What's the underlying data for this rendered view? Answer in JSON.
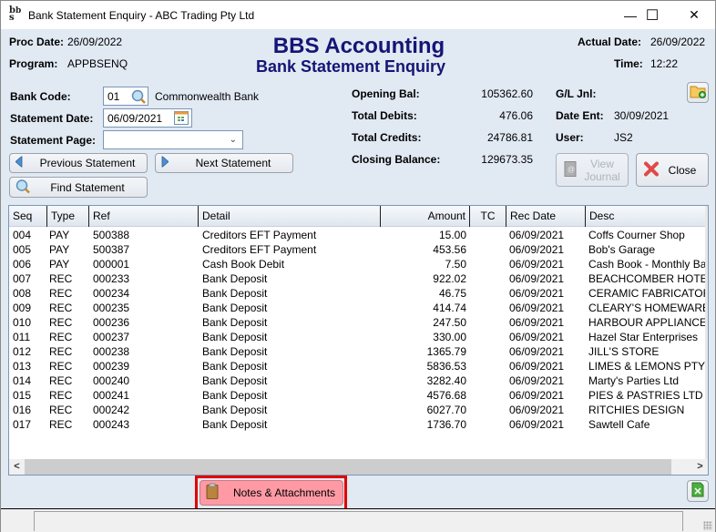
{
  "window": {
    "title": "Bank Statement Enquiry - ABC Trading Pty Ltd",
    "app_icon": "bbs-logo-icon",
    "controls": {
      "minimize": "—",
      "maximize": "☐",
      "close": "✕"
    }
  },
  "header": {
    "proc_date_label": "Proc Date:",
    "proc_date": "26/09/2022",
    "program_label": "Program:",
    "program": "APPBSENQ",
    "title": "BBS Accounting",
    "subtitle": "Bank Statement Enquiry",
    "actual_date_label": "Actual Date:",
    "actual_date": "26/09/2022",
    "time_label": "Time:",
    "time": "12:22",
    "title_color": "#151575"
  },
  "form": {
    "bank_code_label": "Bank Code:",
    "bank_code": "01",
    "bank_name": "Commonwealth Bank",
    "statement_date_label": "Statement Date:",
    "statement_date": "06/09/2021",
    "statement_page_label": "Statement Page:",
    "statement_page": ""
  },
  "buttons": {
    "previous_statement": "Previous Statement",
    "next_statement": "Next Statement",
    "find_statement": "Find Statement",
    "view_journal_line1": "View",
    "view_journal_line2": "Journal",
    "close": "Close",
    "notes_attachments": "Notes & Attachments"
  },
  "summary": {
    "opening_bal_label": "Opening Bal:",
    "opening_bal": "105362.60",
    "total_debits_label": "Total Debits:",
    "total_debits": "476.06",
    "total_credits_label": "Total Credits:",
    "total_credits": "24786.81",
    "closing_balance_label": "Closing Balance:",
    "closing_balance": "129673.35",
    "gl_jnl_label": "G/L Jnl:",
    "gl_jnl": "",
    "date_ent_label": "Date Ent:",
    "date_ent": "30/09/2021",
    "user_label": "User:",
    "user": "JS2"
  },
  "table": {
    "columns": [
      "Seq",
      "Type",
      "Ref",
      "Detail",
      "Amount",
      "TC",
      "Rec Date",
      "Desc"
    ],
    "rows": [
      [
        "004",
        "PAY",
        "500388",
        "Creditors EFT Payment",
        "15.00",
        "",
        "06/09/2021",
        "Coffs Courner Shop"
      ],
      [
        "005",
        "PAY",
        "500387",
        "Creditors EFT Payment",
        "453.56",
        "",
        "06/09/2021",
        "Bob's Garage"
      ],
      [
        "006",
        "PAY",
        "000001",
        "Cash Book Debit",
        "7.50",
        "",
        "06/09/2021",
        "Cash Book - Monthly Bar"
      ],
      [
        "007",
        "REC",
        "000233",
        "Bank Deposit",
        "922.02",
        "",
        "06/09/2021",
        "BEACHCOMBER HOTEL"
      ],
      [
        "008",
        "REC",
        "000234",
        "Bank Deposit",
        "46.75",
        "",
        "06/09/2021",
        "CERAMIC FABRICATORS"
      ],
      [
        "009",
        "REC",
        "000235",
        "Bank Deposit",
        "414.74",
        "",
        "06/09/2021",
        "CLEARY'S HOMEWARES"
      ],
      [
        "010",
        "REC",
        "000236",
        "Bank Deposit",
        "247.50",
        "",
        "06/09/2021",
        "HARBOUR APPLIANCES"
      ],
      [
        "011",
        "REC",
        "000237",
        "Bank Deposit",
        "330.00",
        "",
        "06/09/2021",
        "Hazel Star Enterprises"
      ],
      [
        "012",
        "REC",
        "000238",
        "Bank Deposit",
        "1365.79",
        "",
        "06/09/2021",
        "JILL'S STORE"
      ],
      [
        "013",
        "REC",
        "000239",
        "Bank Deposit",
        "5836.53",
        "",
        "06/09/2021",
        "LIMES & LEMONS PTY L"
      ],
      [
        "014",
        "REC",
        "000240",
        "Bank Deposit",
        "3282.40",
        "",
        "06/09/2021",
        "Marty's Parties Ltd"
      ],
      [
        "015",
        "REC",
        "000241",
        "Bank Deposit",
        "4576.68",
        "",
        "06/09/2021",
        "PIES & PASTRIES LTD"
      ],
      [
        "016",
        "REC",
        "000242",
        "Bank Deposit",
        "6027.70",
        "",
        "06/09/2021",
        "RITCHIES DESIGN"
      ],
      [
        "017",
        "REC",
        "000243",
        "Bank Deposit",
        "1736.70",
        "",
        "06/09/2021",
        "Sawtell Cafe"
      ]
    ]
  },
  "scrollbar": {
    "left_arrow": "<",
    "right_arrow": ">"
  },
  "highlight_color": "#e00000",
  "notes_button_color": "#ff9aa5"
}
